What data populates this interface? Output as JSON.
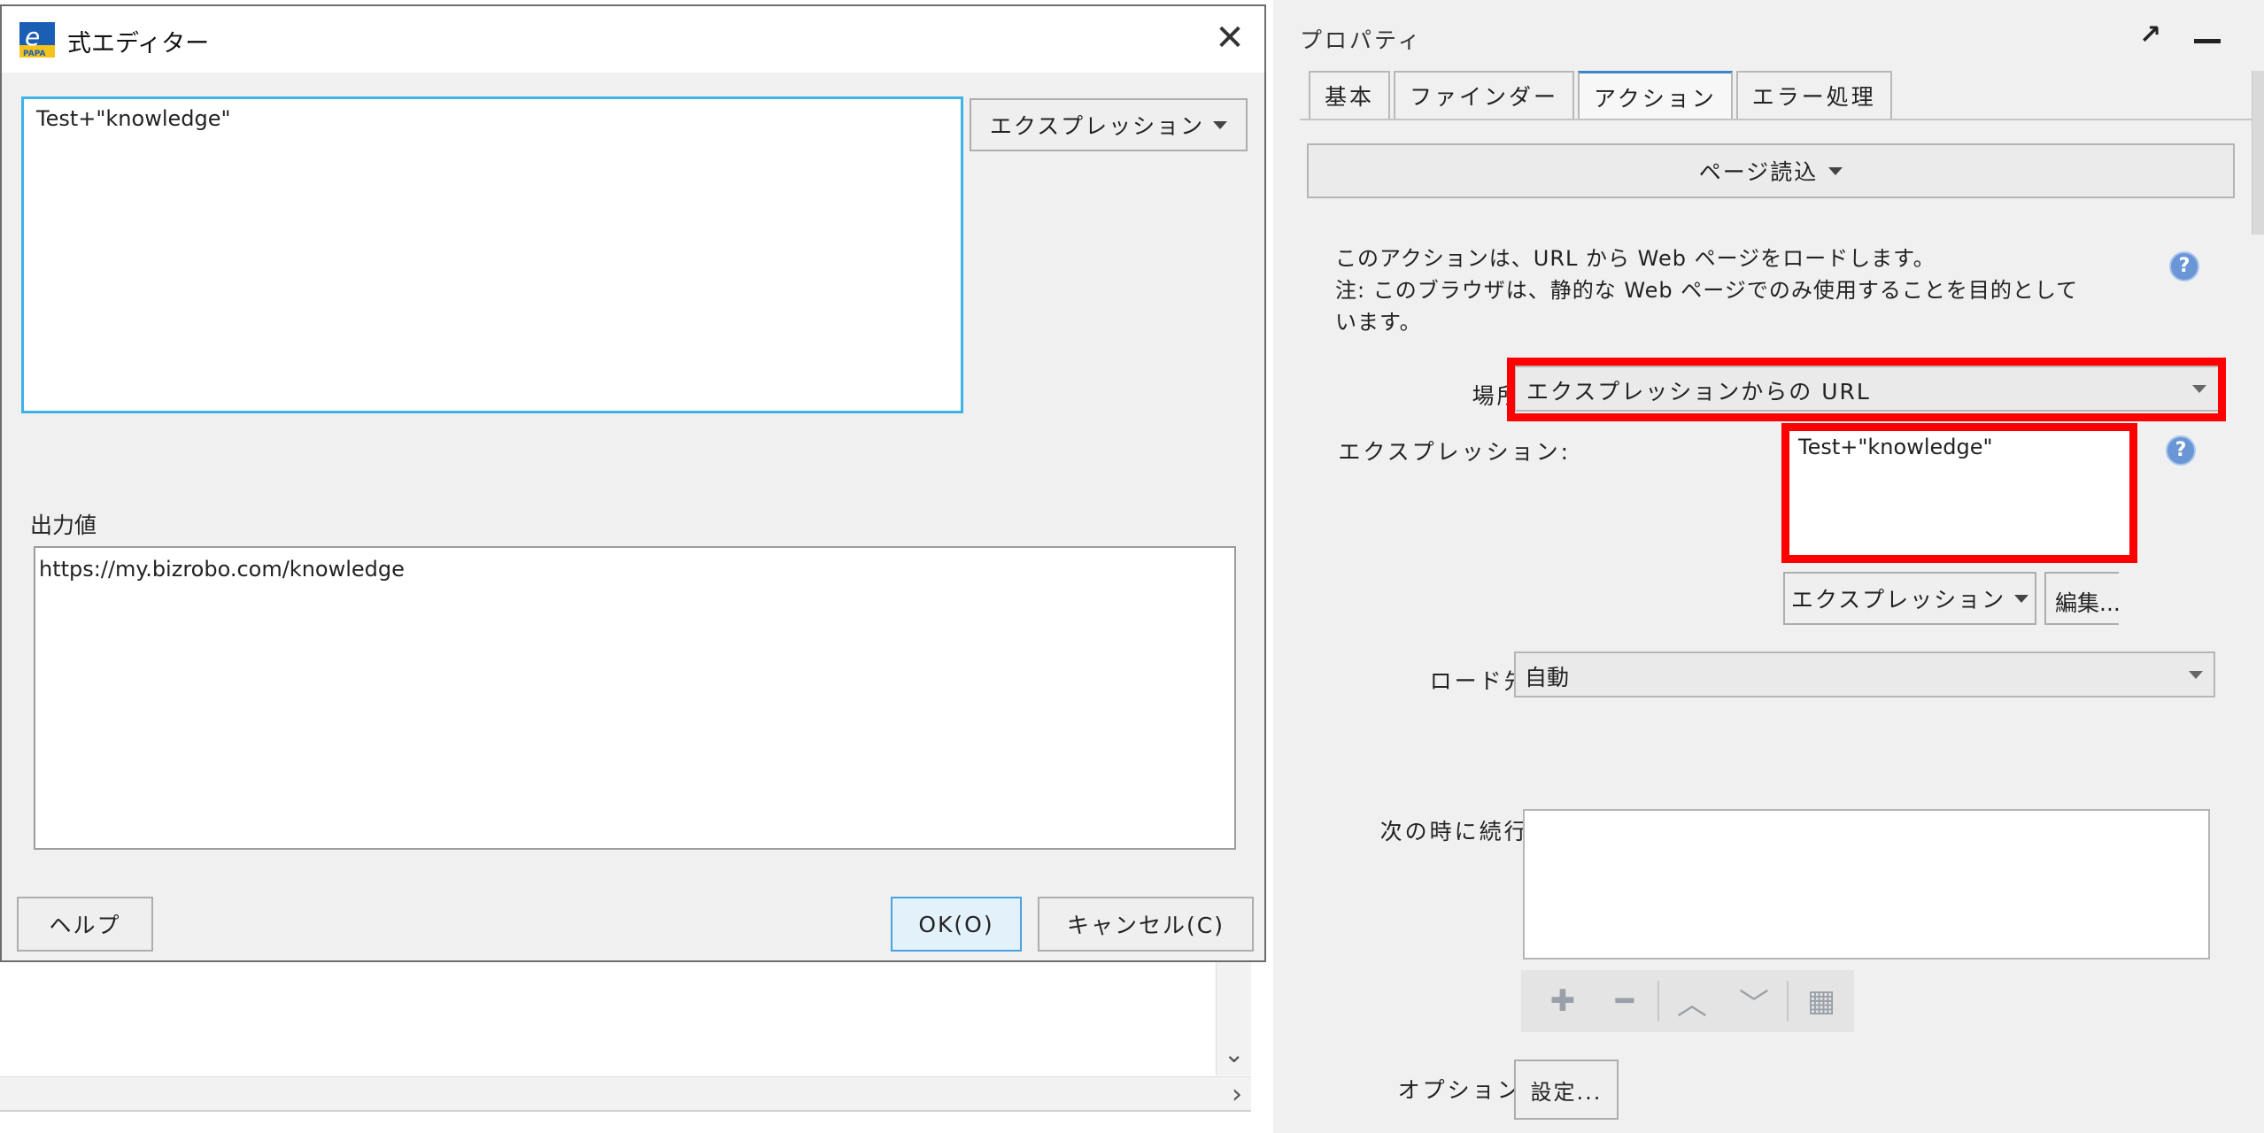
{
  "dialog": {
    "title": "式エディター",
    "app_icon": "epapa-app-icon",
    "close_label": "✕",
    "expression_text": "Test+\"knowledge\"",
    "expression_dropdown_label": "エクスプレッション",
    "output_label": "出力値",
    "output_value": "https://my.bizrobo.com/knowledge",
    "help_label": "ヘルプ",
    "ok_label": "OK(O)",
    "cancel_label": "キャンセル(C)"
  },
  "panel": {
    "title": "プロパティ",
    "tabs": [
      "基本",
      "ファインダー",
      "アクション",
      "エラー処理"
    ],
    "active_tab": "アクション",
    "page_load_label": "ページ読込",
    "description_lines": [
      "このアクションは、URL から Web ページをロードします。",
      "注: このブラウザは、静的な Web ページでのみ使用することを目的として",
      "います。"
    ],
    "location_label": "場所:",
    "location_value": "エクスプレッションからの URL",
    "expression_label": "エクスプレッション:",
    "expression_value": "Test+\"knowledge\"",
    "expression_dropdown_label": "エクスプレッション",
    "edit_label": "編集...",
    "load_to_label": "ロード先:",
    "load_to_value": "自動",
    "continue_label": "次の時に続行:",
    "options_label": "オプション:",
    "settings_label": "設定...",
    "highlight_color": "#ff0000"
  }
}
